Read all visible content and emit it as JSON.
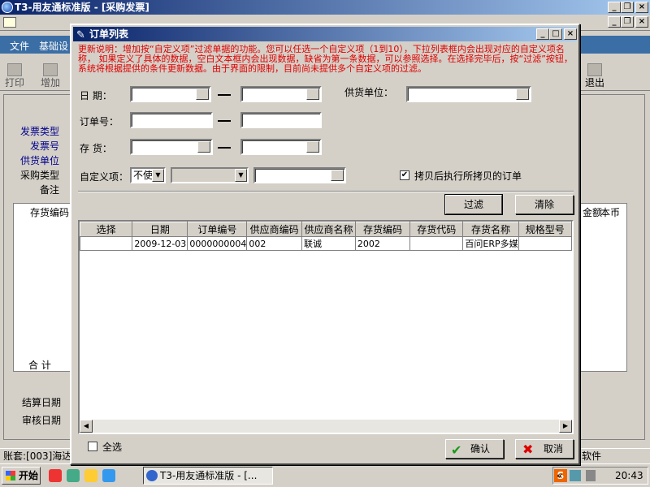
{
  "app": {
    "title": "T3-用友通标准版 - [采购发票]",
    "menu": [
      "文件",
      "基础设"
    ],
    "toolbar": {
      "print": "打印",
      "add": "增加",
      "exit": "退出"
    },
    "form_labels": [
      "发票类型",
      "发票号",
      "供货单位",
      "采购类型",
      "备注"
    ],
    "grid_headers": {
      "code": "存货编码",
      "amount": "金额",
      "currency": "本币"
    },
    "total_label": "合 计",
    "settle_date": "结算日期",
    "audit_date": "审核日期",
    "status_text": "账套:[003]海达",
    "status_right": "软件"
  },
  "dialog": {
    "title": "订单列表",
    "note": "更新说明：增加按“自定义项”过滤单据的功能。您可以任选一个自定义项（1到10），下拉列表框内会出现对应的自定义项名称， 如果定义了具体的数据，空白文本框内会出现数据，缺省为第一条数据，可以参照选择。在选择完毕后，按“过滤”按钮，系统将根据提供的条件更新数据。由于界面的限制，目前尚未提供多个自定义项的过滤。",
    "date_label": "日  期：",
    "order_no_label": "订单号：",
    "inventory_label": "存  货：",
    "supplier_label": "供货单位：",
    "custom_label": "自定义项：",
    "custom_select": "不使",
    "copy_check_label": "拷贝后执行所拷贝的订单",
    "copy_checked": true,
    "filter_button": "过滤",
    "clear_button": "清除",
    "select_all_label": "全选",
    "ok_button": "确认",
    "cancel_button": "取消",
    "table": {
      "headers": [
        "选择",
        "日期",
        "订单编号",
        "供应商编码",
        "供应商名称",
        "存货编码",
        "存货代码",
        "存货名称",
        "规格型号"
      ],
      "rows": [
        [
          "",
          "2009-12-03",
          "0000000004",
          "002",
          "联诚",
          "2002",
          "",
          "百问ERP多媒",
          ""
        ]
      ]
    }
  },
  "taskbar": {
    "start": "开始",
    "task": "T3-用友通标准版 - [...",
    "clock": "20:43"
  },
  "colors": {
    "title_start": "#0a246a",
    "title_end": "#a6caf0",
    "note": "#e00000",
    "menu_bg": "#3a6ea5"
  }
}
